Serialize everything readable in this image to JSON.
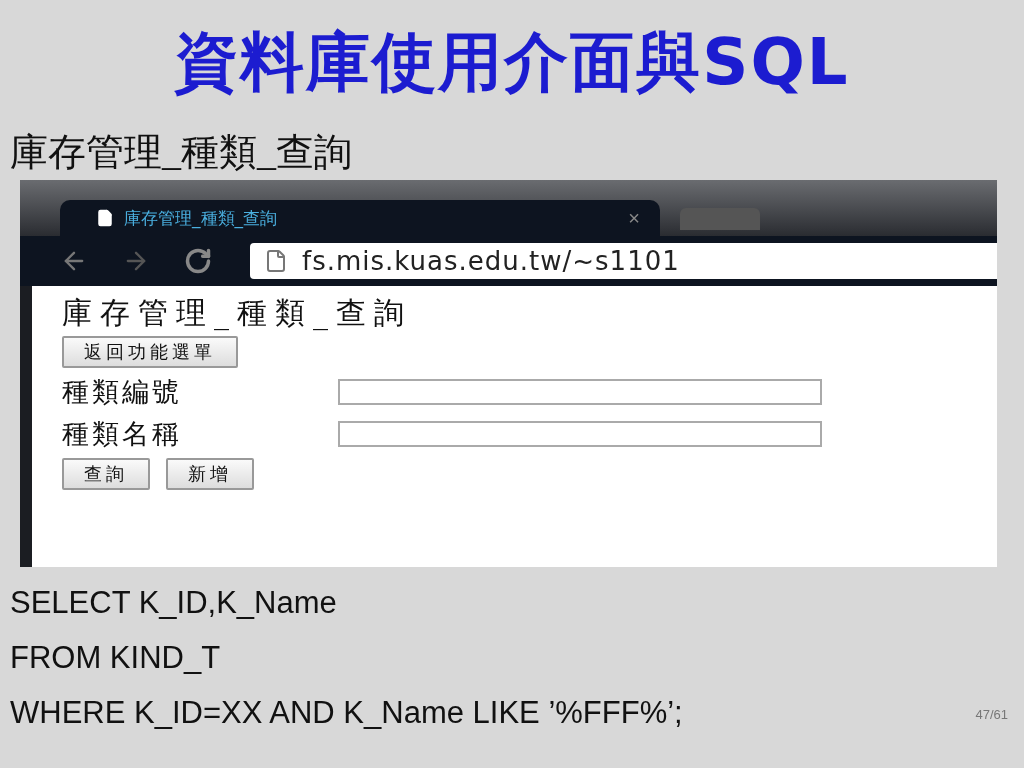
{
  "slide": {
    "title": "資料庫使用介面與SQL",
    "subtitle": "庫存管理_種類_查詢",
    "page_number": "47/61",
    "sql_lines": [
      "SELECT K_ID,K_Name",
      "FROM KIND_T",
      "WHERE K_ID=XX AND K_Name LIKE ’%FFF%’;"
    ]
  },
  "browser": {
    "tab": {
      "title": "庫存管理_種類_查詢",
      "close": "×"
    },
    "address": "fs.mis.kuas.edu.tw/~s1101",
    "page": {
      "heading": "庫存管理_種類_查詢",
      "back_button": "返回功能選單",
      "fields": [
        {
          "label": "種類編號"
        },
        {
          "label": "種類名稱"
        }
      ],
      "buttons": [
        "查詢",
        "新增"
      ]
    }
  }
}
